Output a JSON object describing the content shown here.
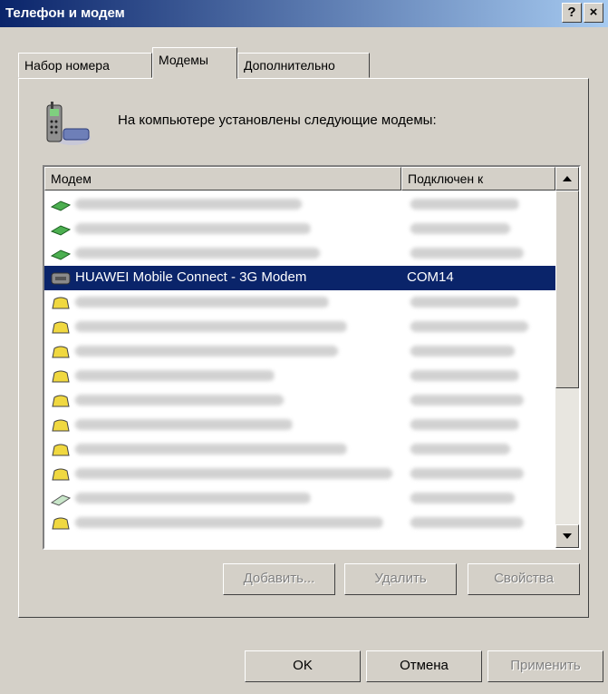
{
  "window": {
    "title": "Телефон и модем",
    "help_label": "?",
    "close_label": "×"
  },
  "tabs": [
    {
      "label": "Набор номера"
    },
    {
      "label": "Модемы"
    },
    {
      "label": "Дополнительно"
    }
  ],
  "heading": "На компьютере установлены следующие модемы:",
  "list": {
    "columns": [
      "Модем",
      "Подключен к"
    ],
    "selected_row": {
      "name": "HUAWEI Mobile Connect - 3G Modem",
      "port": "COM14"
    }
  },
  "buttons": {
    "add": "Добавить...",
    "remove": "Удалить",
    "properties": "Свойства",
    "ok": "OK",
    "cancel": "Отмена",
    "apply": "Применить"
  },
  "colors": {
    "selection": "#0a246a",
    "face": "#d4d0c8",
    "title_start": "#0a246a",
    "title_end": "#a6caf0"
  }
}
